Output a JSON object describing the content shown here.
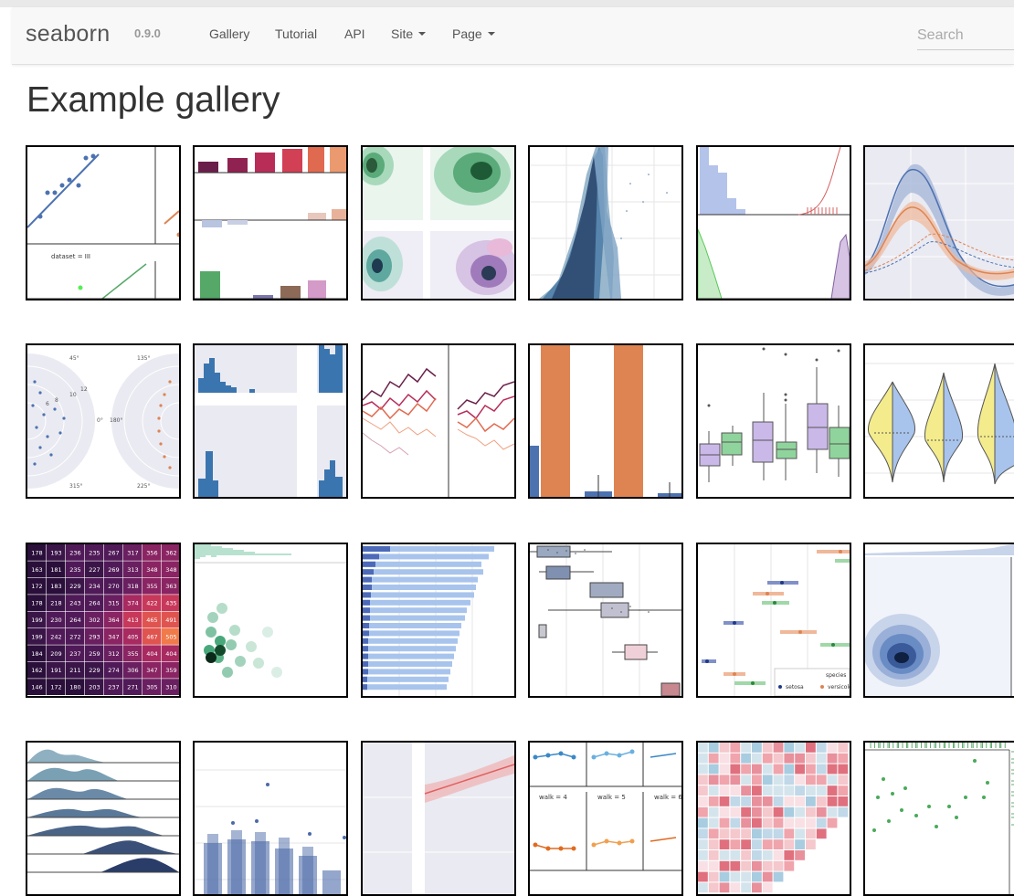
{
  "navbar": {
    "brand": "seaborn",
    "version": "0.9.0",
    "links": [
      "Gallery",
      "Tutorial",
      "API"
    ],
    "dropdowns": [
      "Site",
      "Page"
    ],
    "search_placeholder": "Search"
  },
  "page": {
    "title": "Example gallery"
  },
  "thumb_text": {
    "dataset_label": "dataset = III",
    "polar_ticks": [
      "45°",
      "135°",
      "0°",
      "180°",
      "315°",
      "225°",
      "12",
      "10",
      "8",
      "6"
    ],
    "walk_labels": [
      "walk = 4",
      "walk = 5",
      "walk = 6"
    ],
    "legend_title": "species",
    "legend_items": [
      "setosa",
      "versicolo"
    ],
    "heatmap_rows": [
      [
        "178",
        "193",
        "236",
        "235",
        "267",
        "317",
        "356",
        "362"
      ],
      [
        "163",
        "181",
        "235",
        "227",
        "269",
        "313",
        "348",
        "348"
      ],
      [
        "172",
        "183",
        "229",
        "234",
        "270",
        "318",
        "355",
        "363"
      ],
      [
        "178",
        "218",
        "243",
        "264",
        "315",
        "374",
        "422",
        "435"
      ],
      [
        "199",
        "230",
        "264",
        "302",
        "364",
        "413",
        "465",
        "491"
      ],
      [
        "199",
        "242",
        "272",
        "293",
        "347",
        "405",
        "467",
        "505"
      ],
      [
        "184",
        "209",
        "237",
        "259",
        "312",
        "355",
        "404",
        "404"
      ],
      [
        "162",
        "191",
        "211",
        "229",
        "274",
        "306",
        "347",
        "359"
      ],
      [
        "146",
        "172",
        "180",
        "203",
        "237",
        "271",
        "305",
        "310"
      ]
    ]
  },
  "colors": {
    "navbar_bg": "#f8f8f8",
    "accent_blue": "#4c72b0",
    "accent_orange": "#dd8452",
    "accent_green": "#55a868"
  }
}
